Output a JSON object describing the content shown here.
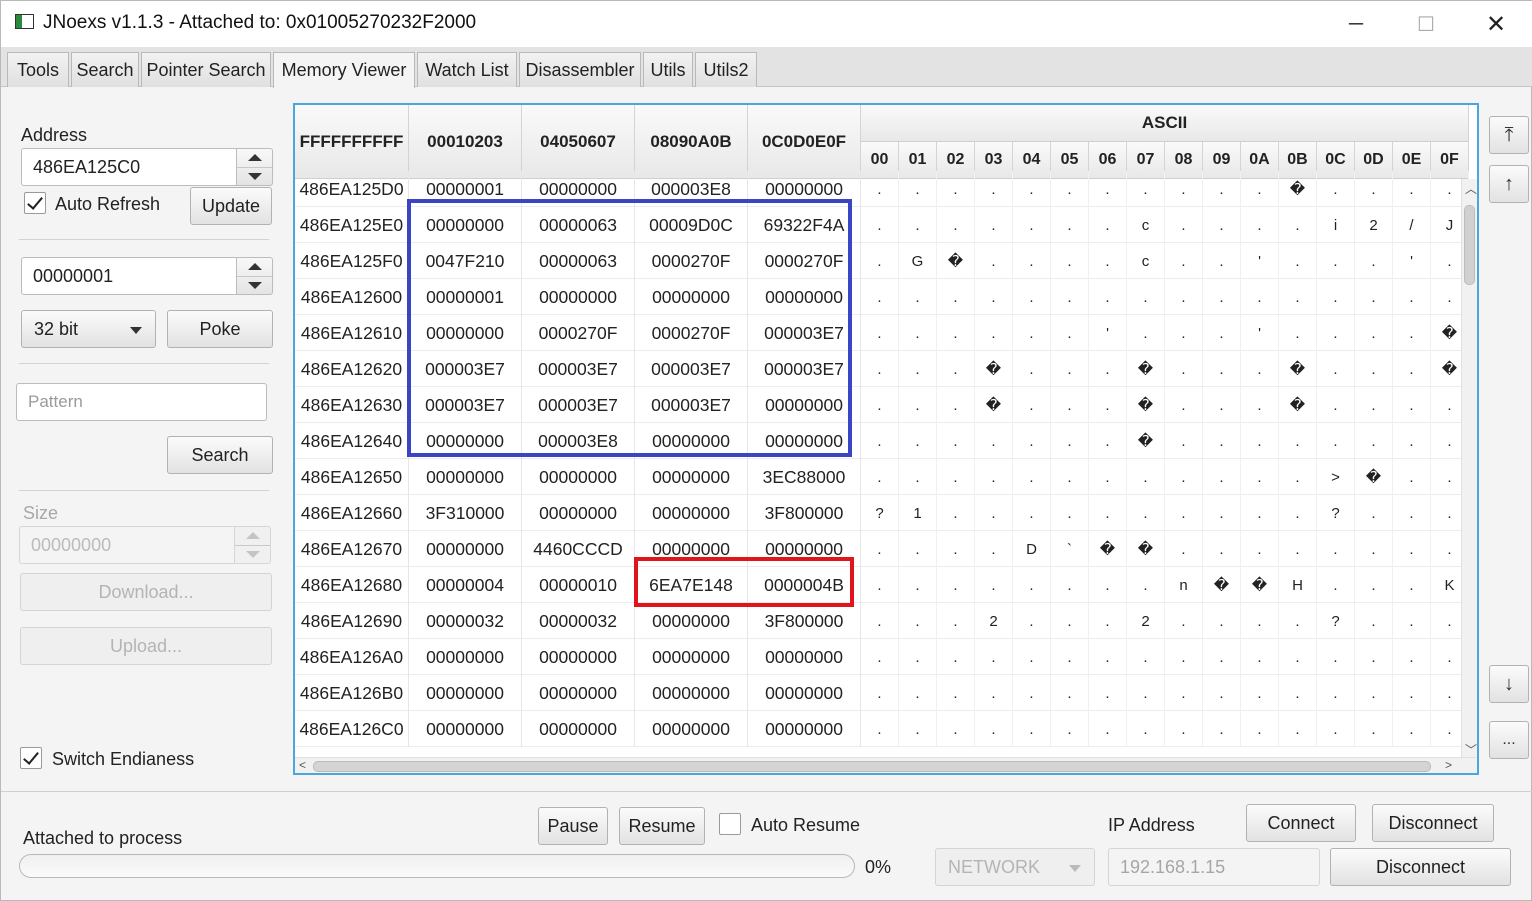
{
  "window": {
    "title": "JNoexs v1.1.3 - Attached to: 0x01005270232F2000",
    "min_icon": "─",
    "max_icon": "☐",
    "close_icon": "✕"
  },
  "tabs": [
    "Tools",
    "Search",
    "Pointer Search",
    "Memory Viewer",
    "Watch List",
    "Disassembler",
    "Utils",
    "Utils2"
  ],
  "active_tab": "Memory Viewer",
  "left": {
    "address_label": "Address",
    "address_value": "486EA125C0",
    "auto_refresh_label": "Auto Refresh",
    "update_button": "Update",
    "poke_value": "00000001",
    "bit_select": "32 bit",
    "poke_button": "Poke",
    "pattern_placeholder": "Pattern",
    "search_button": "Search",
    "size_label": "Size",
    "size_value": "00000000",
    "download_button": "Download...",
    "upload_button": "Upload...",
    "switch_endianess_label": "Switch Endianess"
  },
  "grid": {
    "addr_header": "FFFFFFFFFF",
    "col_headers": [
      "00010203",
      "04050607",
      "08090A0B",
      "0C0D0E0F"
    ],
    "ascii_header": "ASCII",
    "ascii_cols": [
      "00",
      "01",
      "02",
      "03",
      "04",
      "05",
      "06",
      "07",
      "08",
      "09",
      "0A",
      "0B",
      "0C",
      "0D",
      "0E",
      "0F"
    ],
    "rows": [
      {
        "addr": "486EA125D0",
        "vals": [
          "00000001",
          "00000000",
          "000003E8",
          "00000000"
        ],
        "ascii": [
          ".",
          ".",
          ".",
          ".",
          ".",
          ".",
          ".",
          ".",
          ".",
          ".",
          ".",
          "�",
          ".",
          ".",
          ".",
          "."
        ]
      },
      {
        "addr": "486EA125E0",
        "vals": [
          "00000000",
          "00000063",
          "00009D0C",
          "69322F4A"
        ],
        "ascii": [
          ".",
          ".",
          ".",
          ".",
          ".",
          ".",
          ".",
          "c",
          ".",
          ".",
          ".",
          ".",
          "i",
          "2",
          "/",
          "J"
        ]
      },
      {
        "addr": "486EA125F0",
        "vals": [
          "0047F210",
          "00000063",
          "0000270F",
          "0000270F"
        ],
        "ascii": [
          ".",
          "G",
          "�",
          ".",
          ".",
          ".",
          ".",
          "c",
          ".",
          ".",
          "'",
          ".",
          ".",
          ".",
          "'",
          "."
        ]
      },
      {
        "addr": "486EA12600",
        "vals": [
          "00000001",
          "00000000",
          "00000000",
          "00000000"
        ],
        "ascii": [
          ".",
          ".",
          ".",
          ".",
          ".",
          ".",
          ".",
          ".",
          ".",
          ".",
          ".",
          ".",
          ".",
          ".",
          ".",
          "."
        ]
      },
      {
        "addr": "486EA12610",
        "vals": [
          "00000000",
          "0000270F",
          "0000270F",
          "000003E7"
        ],
        "ascii": [
          ".",
          ".",
          ".",
          ".",
          ".",
          ".",
          "'",
          ".",
          ".",
          ".",
          "'",
          ".",
          ".",
          ".",
          ".",
          "�"
        ]
      },
      {
        "addr": "486EA12620",
        "vals": [
          "000003E7",
          "000003E7",
          "000003E7",
          "000003E7"
        ],
        "ascii": [
          ".",
          ".",
          ".",
          "�",
          ".",
          ".",
          ".",
          "�",
          ".",
          ".",
          ".",
          "�",
          ".",
          ".",
          ".",
          "�"
        ]
      },
      {
        "addr": "486EA12630",
        "vals": [
          "000003E7",
          "000003E7",
          "000003E7",
          "00000000"
        ],
        "ascii": [
          ".",
          ".",
          ".",
          "�",
          ".",
          ".",
          ".",
          "�",
          ".",
          ".",
          ".",
          "�",
          ".",
          ".",
          ".",
          "."
        ]
      },
      {
        "addr": "486EA12640",
        "vals": [
          "00000000",
          "000003E8",
          "00000000",
          "00000000"
        ],
        "ascii": [
          ".",
          ".",
          ".",
          ".",
          ".",
          ".",
          ".",
          "�",
          ".",
          ".",
          ".",
          ".",
          ".",
          ".",
          ".",
          "."
        ]
      },
      {
        "addr": "486EA12650",
        "vals": [
          "00000000",
          "00000000",
          "00000000",
          "3EC88000"
        ],
        "ascii": [
          ".",
          ".",
          ".",
          ".",
          ".",
          ".",
          ".",
          ".",
          ".",
          ".",
          ".",
          ".",
          ">",
          "�",
          ".",
          "."
        ]
      },
      {
        "addr": "486EA12660",
        "vals": [
          "3F310000",
          "00000000",
          "00000000",
          "3F800000"
        ],
        "ascii": [
          "?",
          "1",
          ".",
          ".",
          ".",
          ".",
          ".",
          ".",
          ".",
          ".",
          ".",
          ".",
          "?",
          ".",
          ".",
          "."
        ]
      },
      {
        "addr": "486EA12670",
        "vals": [
          "00000000",
          "4460CCCD",
          "00000000",
          "00000000"
        ],
        "ascii": [
          ".",
          ".",
          ".",
          ".",
          "D",
          "`",
          "�",
          "�",
          ".",
          ".",
          ".",
          ".",
          ".",
          ".",
          ".",
          "."
        ]
      },
      {
        "addr": "486EA12680",
        "vals": [
          "00000004",
          "00000010",
          "6EA7E148",
          "0000004B"
        ],
        "ascii": [
          ".",
          ".",
          ".",
          ".",
          ".",
          ".",
          ".",
          ".",
          "n",
          "�",
          "�",
          "H",
          ".",
          ".",
          ".",
          "K"
        ]
      },
      {
        "addr": "486EA12690",
        "vals": [
          "00000032",
          "00000032",
          "00000000",
          "3F800000"
        ],
        "ascii": [
          ".",
          ".",
          ".",
          "2",
          ".",
          ".",
          ".",
          "2",
          ".",
          ".",
          ".",
          ".",
          "?",
          ".",
          ".",
          "."
        ]
      },
      {
        "addr": "486EA126A0",
        "vals": [
          "00000000",
          "00000000",
          "00000000",
          "00000000"
        ],
        "ascii": [
          ".",
          ".",
          ".",
          ".",
          ".",
          ".",
          ".",
          ".",
          ".",
          ".",
          ".",
          ".",
          ".",
          ".",
          ".",
          "."
        ]
      },
      {
        "addr": "486EA126B0",
        "vals": [
          "00000000",
          "00000000",
          "00000000",
          "00000000"
        ],
        "ascii": [
          ".",
          ".",
          ".",
          ".",
          ".",
          ".",
          ".",
          ".",
          ".",
          ".",
          ".",
          ".",
          ".",
          ".",
          ".",
          "."
        ]
      },
      {
        "addr": "486EA126C0",
        "vals": [
          "00000000",
          "00000000",
          "00000000",
          "00000000"
        ],
        "ascii": [
          ".",
          ".",
          ".",
          ".",
          ".",
          ".",
          ".",
          ".",
          ".",
          ".",
          ".",
          ".",
          ".",
          ".",
          ".",
          "."
        ]
      }
    ]
  },
  "nav": {
    "top_icon": "⤒",
    "up_icon": "↑",
    "down_icon": "↓",
    "more_label": "..."
  },
  "bottom": {
    "pause_button": "Pause",
    "resume_button": "Resume",
    "auto_resume_label": "Auto Resume",
    "status_text": "Attached to process",
    "progress_percent": 0,
    "progress_text": "0%",
    "ip_label": "IP Address",
    "connect_button": "Connect",
    "disconnect_button_top": "Disconnect",
    "network_select": "NETWORK",
    "ip_value": "192.168.1.15",
    "disconnect_button_bottom": "Disconnect"
  }
}
